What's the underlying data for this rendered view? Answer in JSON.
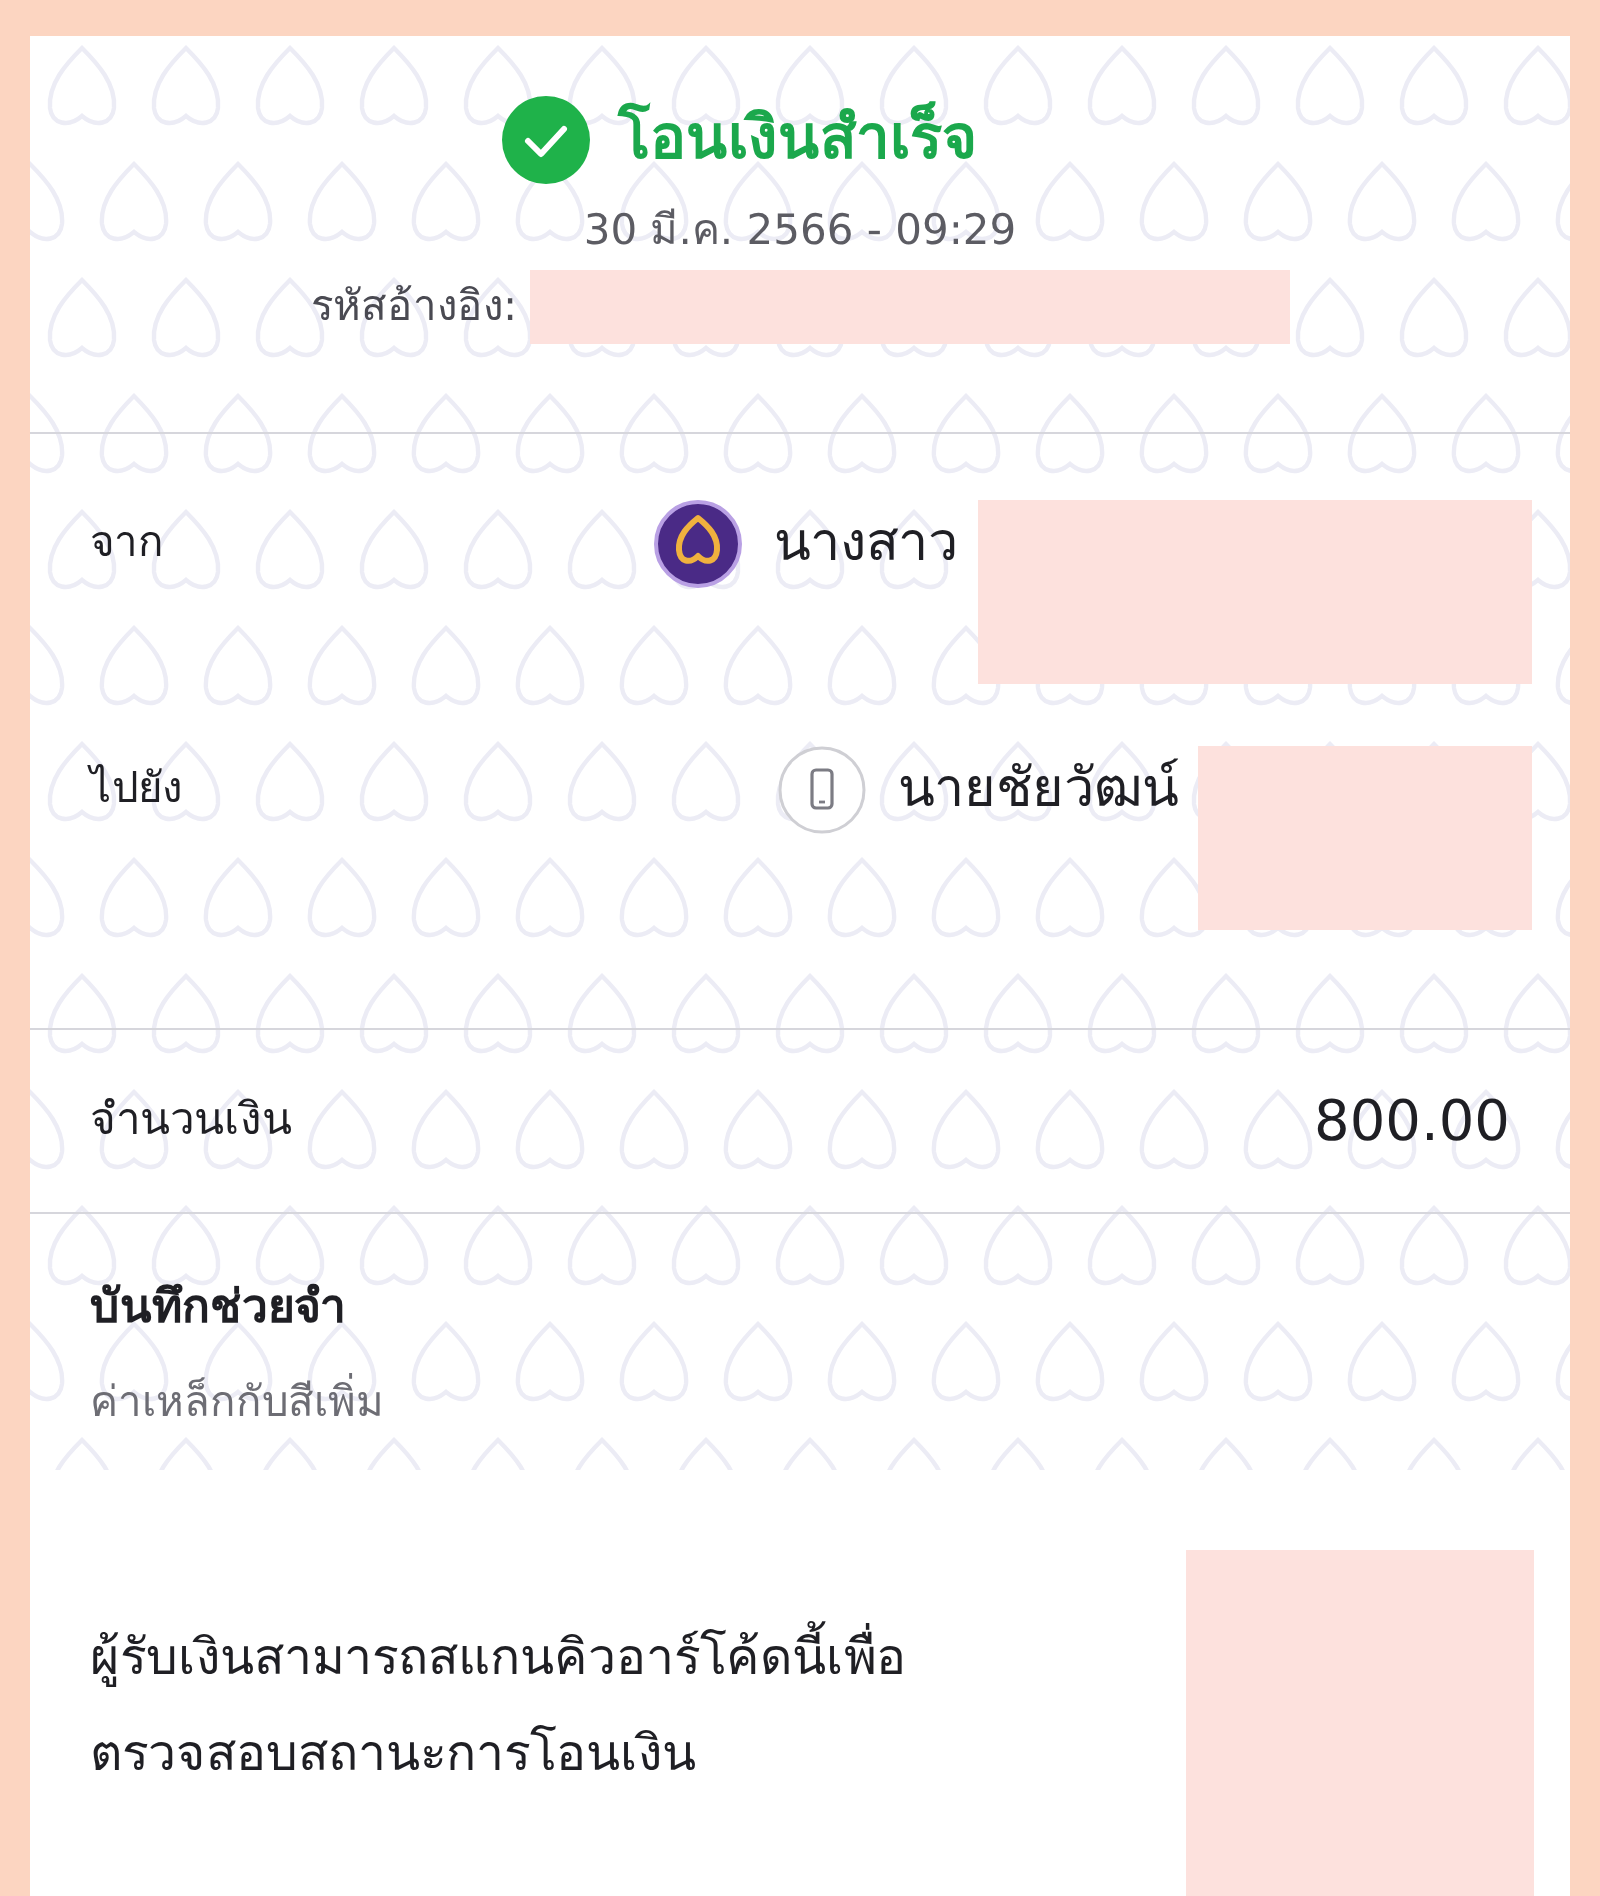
{
  "status_title": "โอนเงินสำเร็จ",
  "date": "30 มี.ค. 2566 - 09:29",
  "reference": {
    "label": "รหัสอ้างอิง:",
    "redacted": true
  },
  "parties": [
    {
      "label": "จาก",
      "kind": "bank",
      "name": "นางสาว",
      "redacted": true
    },
    {
      "label": "ไปยัง",
      "kind": "phone",
      "name": "นายชัยวัฒน์",
      "redacted": true
    }
  ],
  "amount": {
    "label": "จำนวนเงิน",
    "value": "800.00"
  },
  "memo": {
    "label": "บันทึกช่วยจำ",
    "value": "ค่าเหล็กกับสีเพิ่ม"
  },
  "qr_note": {
    "lines": [
      "ผู้รับเงินสามารถสแกนคิวอาร์โค้ดนี้เพื่อ",
      "ตรวจสอบสถานะการโอนเงิน"
    ],
    "redacted": true
  }
}
